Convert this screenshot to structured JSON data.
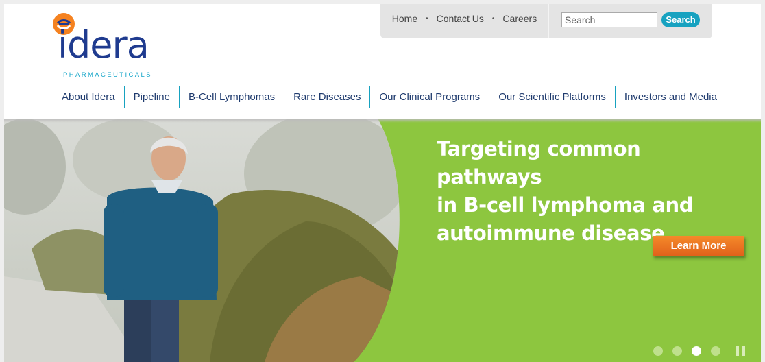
{
  "logo": {
    "wordmark": "idera",
    "subtitle": "PHARMACEUTICALS",
    "mark_colors": [
      "#f58220",
      "#1f3b8f"
    ]
  },
  "utility": {
    "links": [
      {
        "label": "Home"
      },
      {
        "label": "Contact Us"
      },
      {
        "label": "Careers"
      }
    ],
    "search": {
      "placeholder": "Search",
      "button_label": "Search"
    }
  },
  "nav": {
    "items": [
      {
        "label": "About Idera"
      },
      {
        "label": "Pipeline"
      },
      {
        "label": "B-Cell Lymphomas"
      },
      {
        "label": "Rare Diseases"
      },
      {
        "label": "Our Clinical Programs"
      },
      {
        "label": "Our Scientific Platforms"
      },
      {
        "label": "Investors and Media"
      }
    ]
  },
  "hero": {
    "headline_lines": [
      "Targeting common pathways",
      "in B-cell lymphoma and",
      "autoimmune disease"
    ],
    "cta_label": "Learn More",
    "slides_total": 4,
    "active_slide": 3,
    "accent_color": "#8dc63f",
    "cta_color": "#f07a22"
  },
  "colors": {
    "brand_blue": "#1f3b8f",
    "teal": "#17a2c0",
    "nav_text": "#1f3b6e"
  }
}
